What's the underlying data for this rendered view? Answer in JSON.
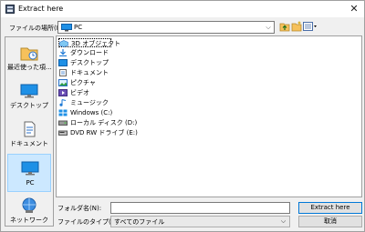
{
  "window": {
    "title": "Extract here",
    "close_glyph": "✕"
  },
  "lookin": {
    "label": "ファイルの場所(I):",
    "value": "PC",
    "arrow": "⌵"
  },
  "places": [
    {
      "label": "最近使った項...",
      "icon": "recent-places-icon",
      "selected": false
    },
    {
      "label": "デスクトップ",
      "icon": "desktop-icon",
      "selected": false
    },
    {
      "label": "ドキュメント",
      "icon": "documents-icon",
      "selected": false
    },
    {
      "label": "PC",
      "icon": "pc-icon",
      "selected": true
    },
    {
      "label": "ネットワーク",
      "icon": "network-icon",
      "selected": false
    }
  ],
  "files": [
    {
      "name": "3D オブジェクト",
      "icon": "3d-objects-icon"
    },
    {
      "name": "ダウンロード",
      "icon": "downloads-icon"
    },
    {
      "name": "デスクトップ",
      "icon": "desktop-icon"
    },
    {
      "name": "ドキュメント",
      "icon": "documents-icon"
    },
    {
      "name": "ピクチャ",
      "icon": "pictures-icon"
    },
    {
      "name": "ビデオ",
      "icon": "videos-icon"
    },
    {
      "name": "ミュージック",
      "icon": "music-icon"
    },
    {
      "name": "Windows (C:)",
      "icon": "drive-c-icon"
    },
    {
      "name": "ローカル ディスク (D:)",
      "icon": "local-disk-icon"
    },
    {
      "name": "DVD RW ドライブ (E:)",
      "icon": "dvd-drive-icon"
    }
  ],
  "filename": {
    "label": "フォルダ名(N):",
    "value": ""
  },
  "filetype": {
    "label": "ファイルのタイプ(T):",
    "value": "すべてのファイル",
    "arrow": "⌵"
  },
  "buttons": {
    "ok": "Extract here",
    "cancel": "取消"
  },
  "colors": {
    "selection": "#cce8ff",
    "accent": "#0078d7",
    "folder": "#f6c15b"
  }
}
